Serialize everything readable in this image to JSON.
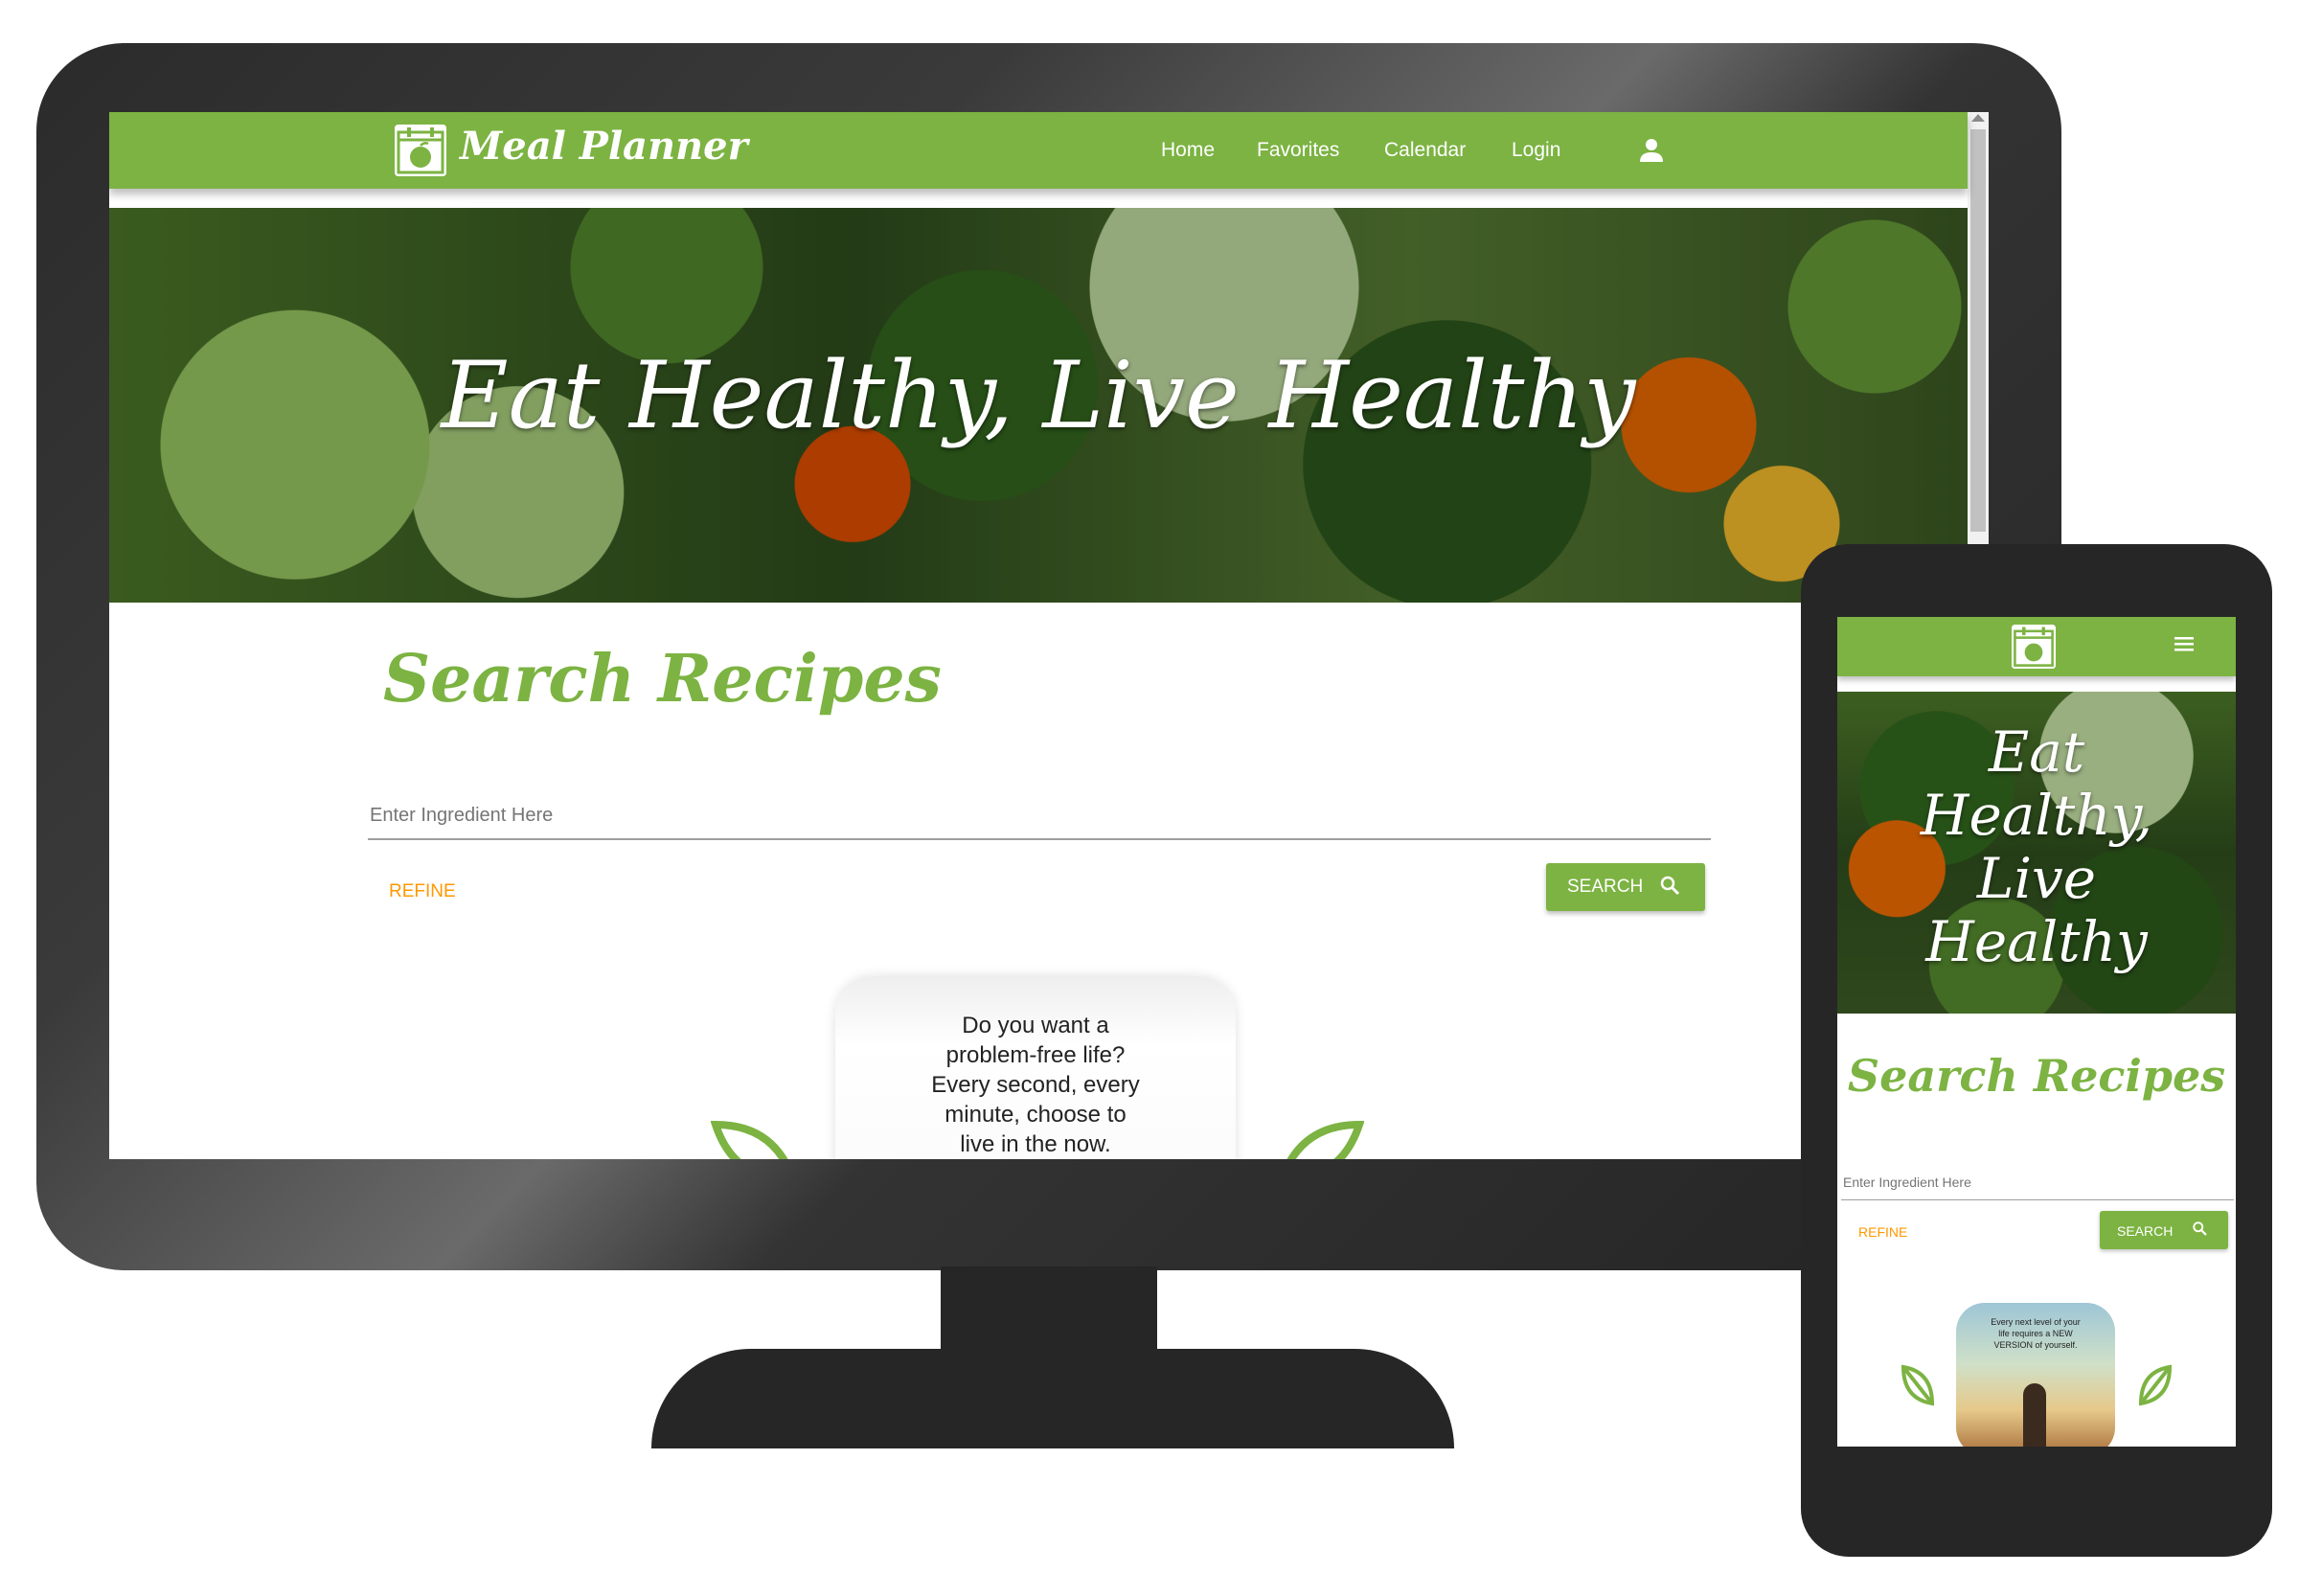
{
  "brand": {
    "name": "Meal Planner",
    "primary_color": "#7cb342",
    "accent_color": "#ff9800"
  },
  "desktop": {
    "nav": {
      "items": [
        {
          "label": "Home"
        },
        {
          "label": "Favorites"
        },
        {
          "label": "Calendar"
        },
        {
          "label": "Login"
        }
      ],
      "user_icon": "person-icon"
    },
    "hero": {
      "title": "Eat Healthy, Live Healthy"
    },
    "search": {
      "title": "Search Recipes",
      "placeholder": "Enter Ingredient Here",
      "refine_label": "REFINE",
      "search_label": "SEARCH",
      "search_icon": "magnifier-icon"
    },
    "quote": {
      "lines": [
        "Do you want a",
        "problem-free life?",
        "Every second, every",
        "minute, choose to",
        "live in the now."
      ]
    }
  },
  "mobile": {
    "nav": {
      "menu_icon": "hamburger-icon"
    },
    "hero": {
      "title_lines": [
        "Eat",
        "Healthy,",
        "Live",
        "Healthy"
      ]
    },
    "search": {
      "title": "Search Recipes",
      "placeholder": "Enter Ingredient Here",
      "refine_label": "REFINE",
      "search_label": "SEARCH"
    },
    "quote": {
      "lines": [
        "Every next level of your",
        "life requires a NEW",
        "VERSION of yourself."
      ]
    }
  }
}
